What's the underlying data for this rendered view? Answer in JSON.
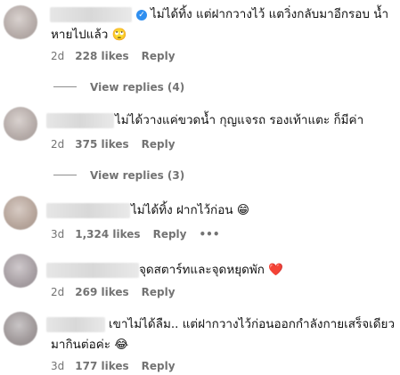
{
  "comments": [
    {
      "text_line1": "ไม่ได้ทิ้ง แต่ฝากวางไว้ แตวิ่งกลับมาอีกรอบ น้ำ",
      "text_line2": "หายไปแล้ว 🙄",
      "verified_icon": "✓",
      "age": "2d",
      "likes": "228 likes",
      "reply": "Reply",
      "view_replies": "View replies (4)"
    },
    {
      "text_line1": "ไม่ได้วางแค่ขวดน้ำ กุญแจรถ รองเท้าแตะ ก็มีค่า",
      "age": "2d",
      "likes": "375 likes",
      "reply": "Reply",
      "view_replies": "View replies (3)"
    },
    {
      "text_line1": "ไม่ได้ทิ้ง ฝากไว้ก่อน 😁",
      "age": "3d",
      "likes": "1,324 likes",
      "reply": "Reply",
      "more": "•••"
    },
    {
      "text_line1": "จุดสตาร์ทและจุดหยุดพัก ❤️",
      "age": "2d",
      "likes": "269 likes",
      "reply": "Reply"
    },
    {
      "text_line1": "เขาไม่ได้ลืม.. แต่ฝากวางไว้ก่อนออกกำลังกายเสร็จเดียว",
      "text_line2": "มากินต่อค่ะ 😂",
      "age": "3d",
      "likes": "177 likes",
      "reply": "Reply"
    }
  ]
}
